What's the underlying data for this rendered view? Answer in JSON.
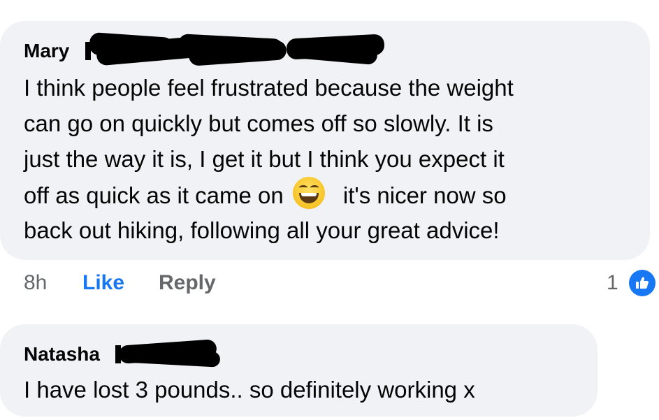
{
  "comments": [
    {
      "author": "Mary",
      "lines": [
        "I think people feel frustrated because the weight",
        "can go on quickly but comes off so slowly. It is",
        "just the way it is, I get it but I think you expect it",
        "off as quick as it came on",
        "back out hiking, following all your great advice!"
      ],
      "line4_after_emoji": "it's nicer now so",
      "emoji": "grinning-face-with-smiling-eyes",
      "time": "8h",
      "like_label": "Like",
      "reply_label": "Reply",
      "reaction_count": "1",
      "reaction_icon": "like-thumb-icon"
    },
    {
      "author": "Natasha",
      "text": "I have lost 3 pounds.. so definitely working x"
    }
  ],
  "colors": {
    "bubble": "#f0f2f5",
    "link_blue": "#1877f2",
    "meta_gray": "#65676b"
  }
}
